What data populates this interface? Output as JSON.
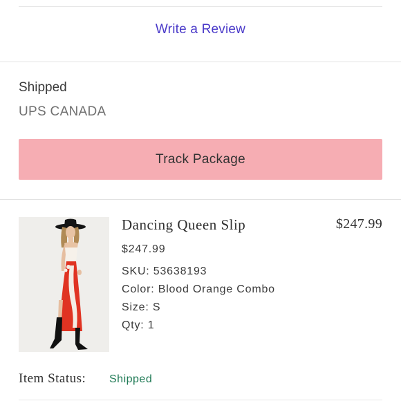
{
  "review": {
    "link_label": "Write a Review"
  },
  "shipment": {
    "status": "Shipped",
    "carrier": "UPS CANADA",
    "track_label": "Track Package"
  },
  "item": {
    "name": "Dancing Queen Slip",
    "total": "$247.99",
    "price": "$247.99",
    "sku": "SKU: 53638193",
    "color": "Color: Blood Orange Combo",
    "size": "Size: S",
    "qty": "Qty: 1",
    "status_label": "Item Status:",
    "status_value": "Shipped"
  },
  "colors": {
    "link": "#4a3ac9",
    "track_button": "#f6adb3",
    "status_shipped": "#1f7a55"
  }
}
